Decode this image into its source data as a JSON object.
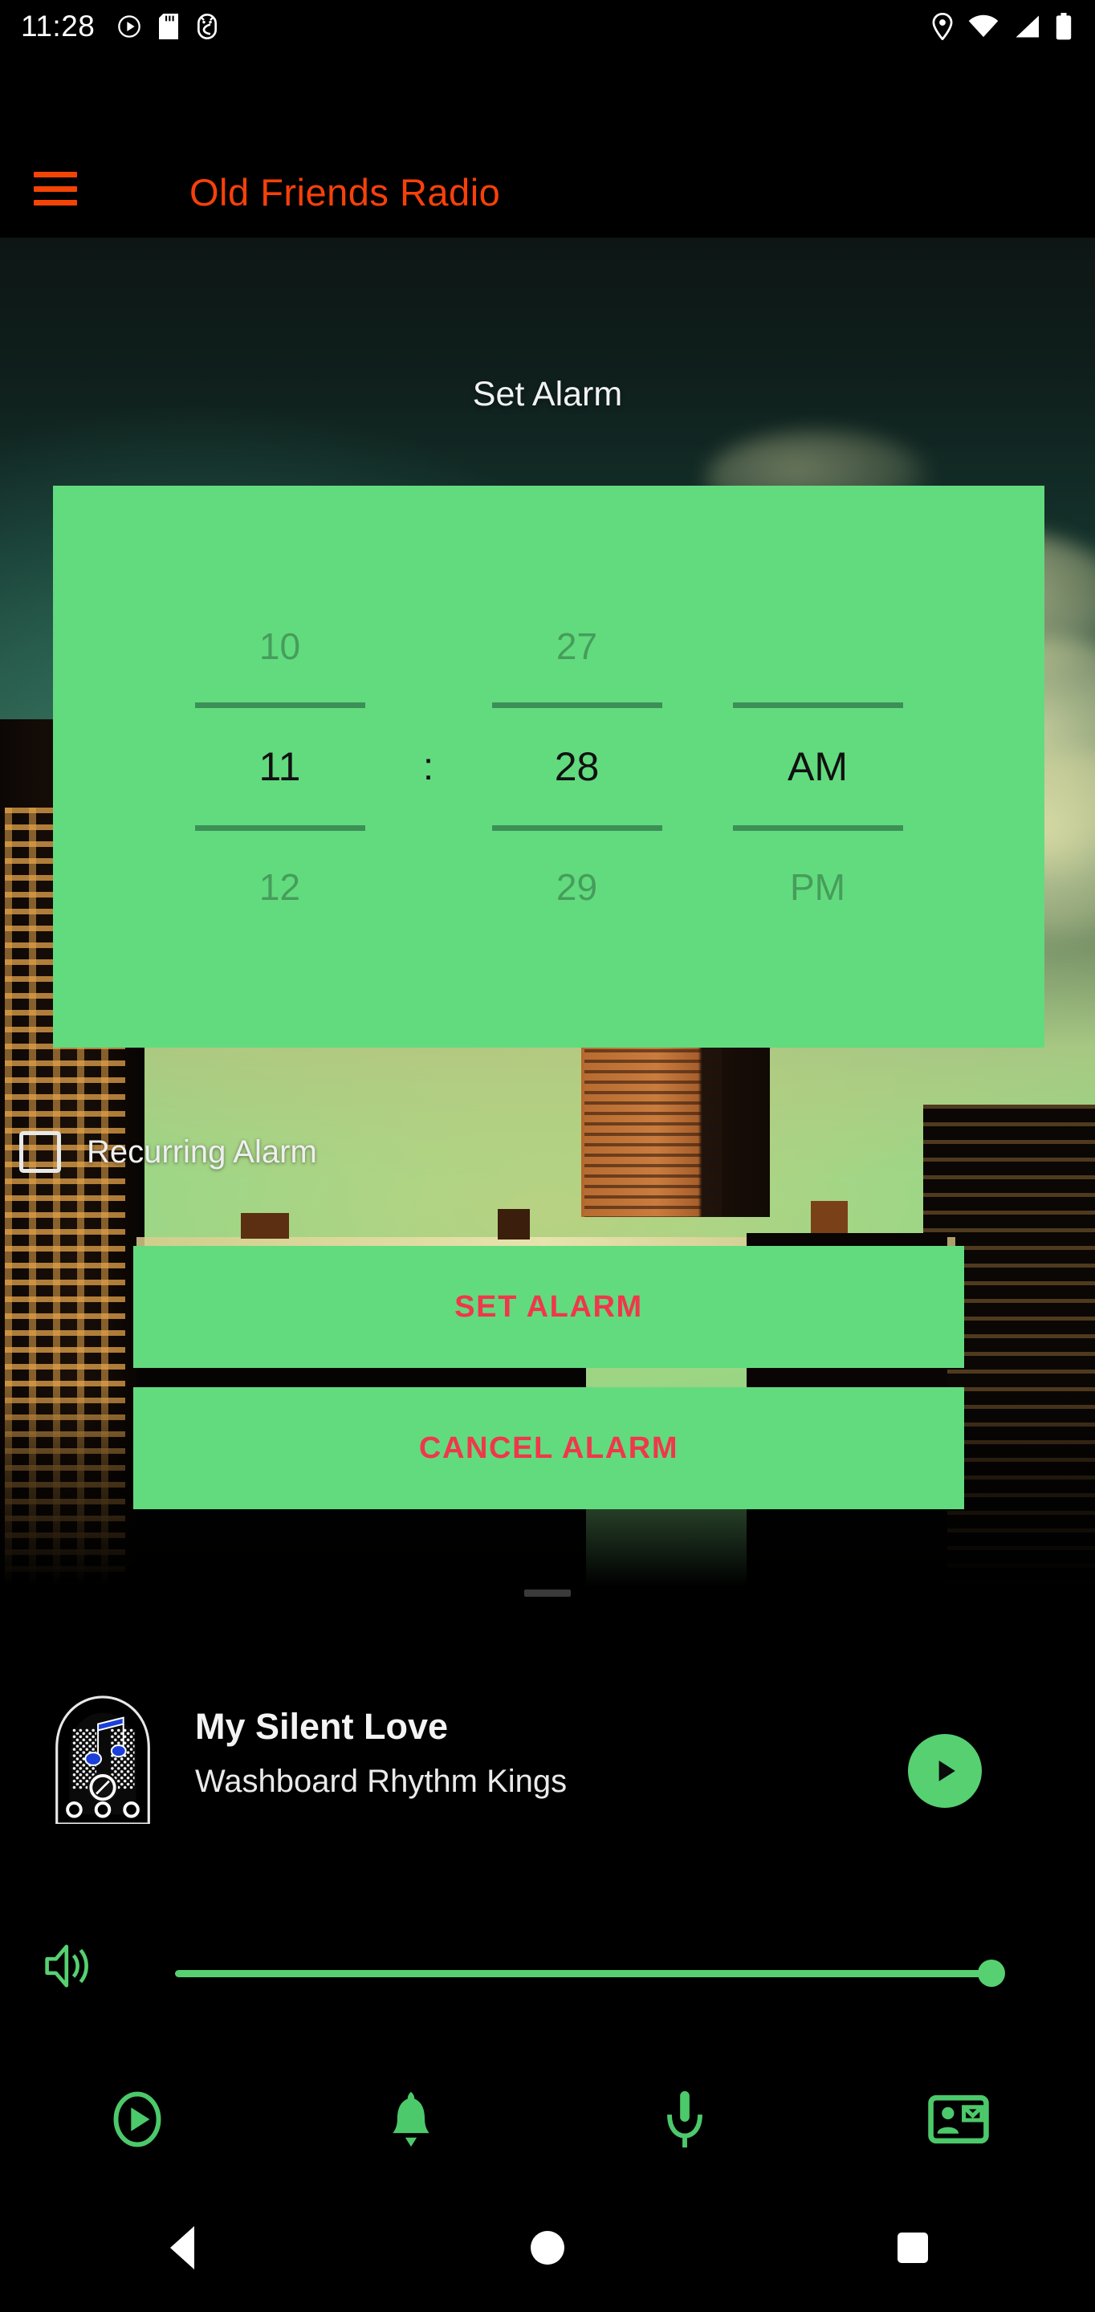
{
  "status_bar": {
    "clock": "11:28",
    "left_icons": [
      "play-circle-icon",
      "sd-card-icon",
      "android-debug-icon"
    ],
    "right_icons": [
      "location-pin-icon",
      "wifi-icon",
      "cell-signal-icon",
      "battery-icon"
    ]
  },
  "app_bar": {
    "menu_icon": "hamburger-menu-icon",
    "title": "Old Friends Radio",
    "title_color": "#F7400A"
  },
  "screen": {
    "heading": "Set Alarm"
  },
  "time_picker": {
    "accent_color": "#62DB7E",
    "hour": {
      "prev": "10",
      "selected": "11",
      "next": "12"
    },
    "separator": ":",
    "minute": {
      "prev": "27",
      "selected": "28",
      "next": "29"
    },
    "meridiem": {
      "prev": "",
      "selected": "AM",
      "next": "PM"
    }
  },
  "recurring": {
    "label": "Recurring Alarm",
    "checked": false
  },
  "actions": {
    "set_label": "SET ALARM",
    "cancel_label": "CANCEL ALARM",
    "text_color": "#F0374C",
    "background_color": "#62DB7E"
  },
  "now_playing": {
    "album_art_icon": "vintage-radio-icon",
    "title": "My Silent Love",
    "artist": "Washboard Rhythm Kings",
    "play_button_icon": "play-icon",
    "play_button_color": "#56D071"
  },
  "volume": {
    "icon": "speaker-volume-icon",
    "level_percent": 100,
    "color": "#56D071"
  },
  "bottom_nav": {
    "items": [
      {
        "name": "player",
        "icon": "play-circle-outline-icon"
      },
      {
        "name": "alarm",
        "icon": "bell-icon"
      },
      {
        "name": "microphone",
        "icon": "microphone-icon"
      },
      {
        "name": "contact",
        "icon": "contact-card-icon"
      }
    ],
    "color": "#4CC96A"
  },
  "system_nav": {
    "back": "back-triangle-icon",
    "home": "home-circle-icon",
    "recents": "recents-square-icon"
  }
}
